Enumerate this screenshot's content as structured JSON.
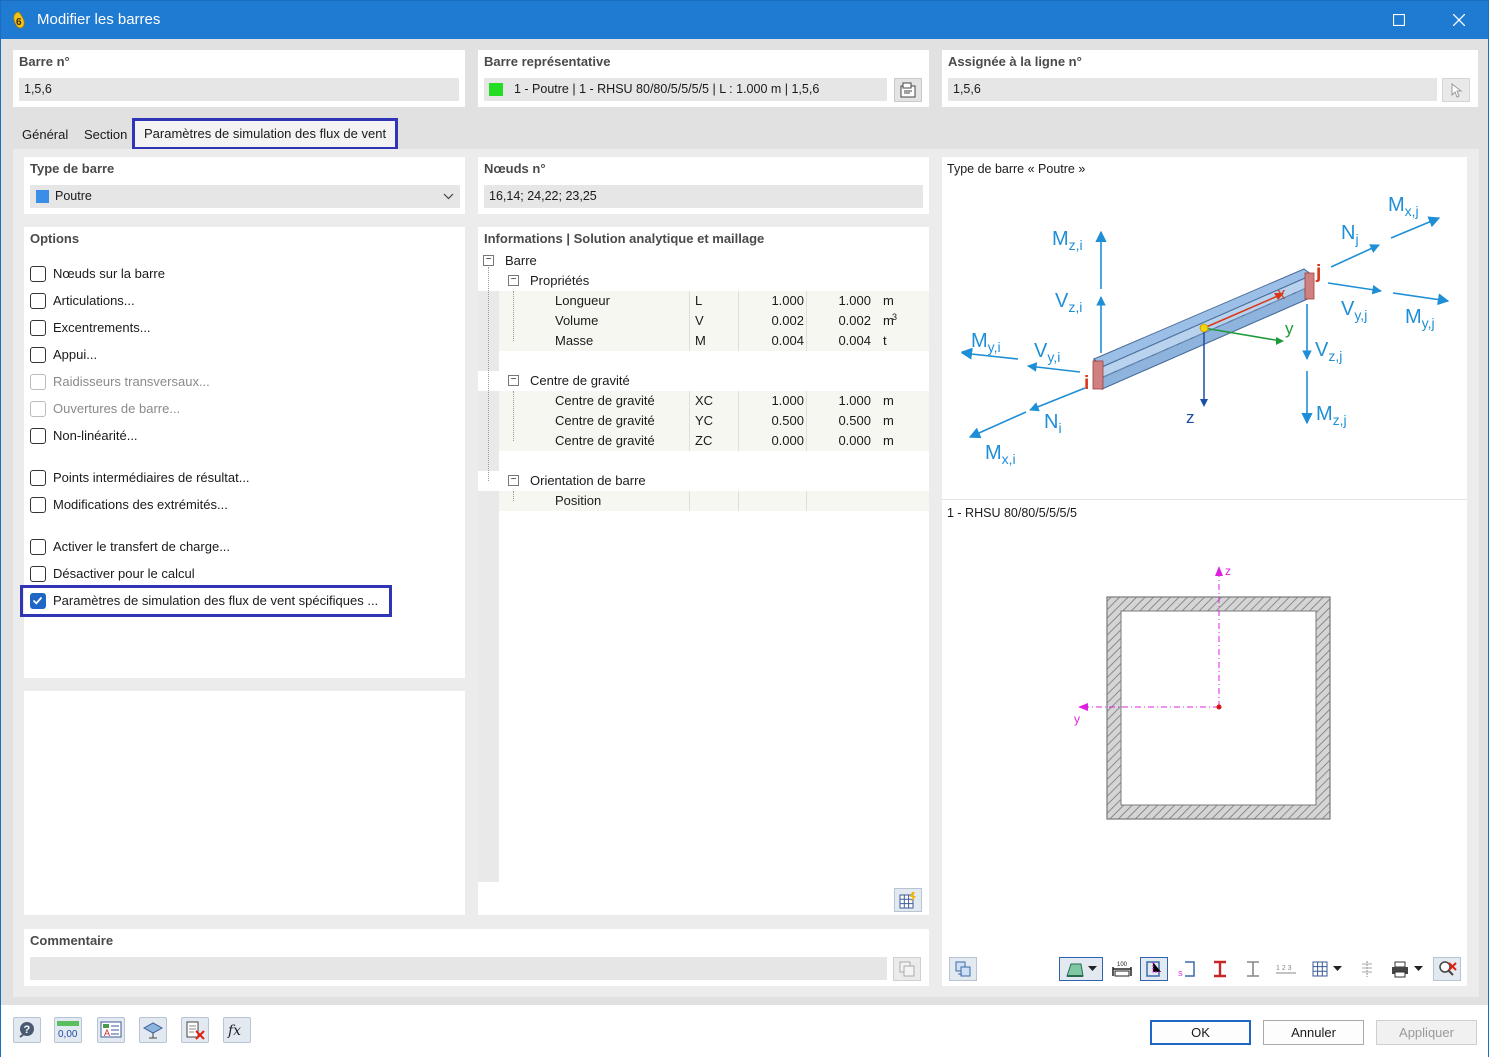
{
  "window": {
    "title": "Modifier les barres"
  },
  "header": {
    "member_no": {
      "label": "Barre n°",
      "value": "1,5,6"
    },
    "representative": {
      "label": "Barre représentative",
      "value": "1 - Poutre | 1 - RHSU 80/80/5/5/5/5 | L : 1.000 m | 1,5,6",
      "color": "#22dd22"
    },
    "assigned_line": {
      "label": "Assignée à la ligne n°",
      "value": "1,5,6"
    }
  },
  "tabs": [
    {
      "label": "Général"
    },
    {
      "label": "Section"
    },
    {
      "label": "Paramètres de simulation des flux de vent",
      "active": true
    }
  ],
  "member_type": {
    "label": "Type de barre",
    "value": "Poutre",
    "color": "#3a8ee8"
  },
  "nodes": {
    "label": "Nœuds n°",
    "value": "16,14; 24,22; 23,25"
  },
  "options": {
    "label": "Options",
    "items": [
      {
        "label": "Nœuds sur la barre",
        "checked": false,
        "disabled": false
      },
      {
        "label": "Articulations...",
        "checked": false,
        "disabled": false
      },
      {
        "label": "Excentrements...",
        "checked": false,
        "disabled": false
      },
      {
        "label": "Appui...",
        "checked": false,
        "disabled": false
      },
      {
        "label": "Raidisseurs transversaux...",
        "checked": false,
        "disabled": true
      },
      {
        "label": "Ouvertures de barre...",
        "checked": false,
        "disabled": true
      },
      {
        "label": "Non-linéarité...",
        "checked": false,
        "disabled": false
      },
      {
        "label": "Points intermédiaires de résultat...",
        "checked": false,
        "disabled": false
      },
      {
        "label": "Modifications des extrémités...",
        "checked": false,
        "disabled": false
      },
      {
        "label": "Activer le transfert de charge...",
        "checked": false,
        "disabled": false
      },
      {
        "label": "Désactiver pour le calcul",
        "checked": false,
        "disabled": false
      },
      {
        "label": "Paramètres de simulation des flux de vent spécifiques ...",
        "checked": true,
        "disabled": false
      }
    ]
  },
  "info": {
    "label": "Informations | Solution analytique et maillage",
    "root": "Barre",
    "groups": [
      {
        "name": "Propriétés",
        "rows": [
          {
            "name": "Longueur",
            "sym": "L",
            "v1": "1.000",
            "v2": "1.000",
            "unit": "m"
          },
          {
            "name": "Volume",
            "sym": "V",
            "v1": "0.002",
            "v2": "0.002",
            "unit": "m",
            "unit_sup": "3"
          },
          {
            "name": "Masse",
            "sym": "M",
            "v1": "0.004",
            "v2": "0.004",
            "unit": "t"
          }
        ]
      },
      {
        "name": "Centre de gravité",
        "rows": [
          {
            "name": "Centre de gravité",
            "sym": "XC",
            "v1": "1.000",
            "v2": "1.000",
            "unit": "m"
          },
          {
            "name": "Centre de gravité",
            "sym": "YC",
            "v1": "0.500",
            "v2": "0.500",
            "unit": "m"
          },
          {
            "name": "Centre de gravité",
            "sym": "ZC",
            "v1": "0.000",
            "v2": "0.000",
            "unit": "m"
          }
        ]
      },
      {
        "name": "Orientation de barre",
        "rows": [
          {
            "name": "Position",
            "sym": "",
            "v1": "",
            "v2": "",
            "unit": ""
          }
        ]
      }
    ]
  },
  "preview": {
    "member_type_caption": "Type de barre « Poutre »",
    "section_caption": "1 - RHSU 80/80/5/5/5/5",
    "diagram_labels": {
      "mzi": "M",
      "mzi_sub": "z,i",
      "vzi": "V",
      "vzi_sub": "z,i",
      "myi": "M",
      "myi_sub": "y,i",
      "vyi": "V",
      "vyi_sub": "y,i",
      "ni": "N",
      "ni_sub": "i",
      "mxi": "M",
      "mxi_sub": "x,i",
      "nj": "N",
      "nj_sub": "j",
      "mxj": "M",
      "mxj_sub": "x,j",
      "vyj": "V",
      "vyj_sub": "y,j",
      "myj": "M",
      "myj_sub": "y,j",
      "vzj": "V",
      "vzj_sub": "z,j",
      "mzj": "M",
      "mzj_sub": "z,j",
      "node_i": "i",
      "node_j": "j",
      "axis_x": "x",
      "axis_y": "y",
      "axis_z": "z"
    },
    "section_axes": {
      "z": "z",
      "y": "y"
    }
  },
  "comment": {
    "label": "Commentaire",
    "value": ""
  },
  "buttons": {
    "ok": "OK",
    "cancel": "Annuler",
    "apply": "Appliquer"
  },
  "colors": {
    "accent": "#1f66c6",
    "highlight": "#2f35b5",
    "diagram_blue": "#1e8fd6",
    "section_axis": "#e020e0"
  }
}
